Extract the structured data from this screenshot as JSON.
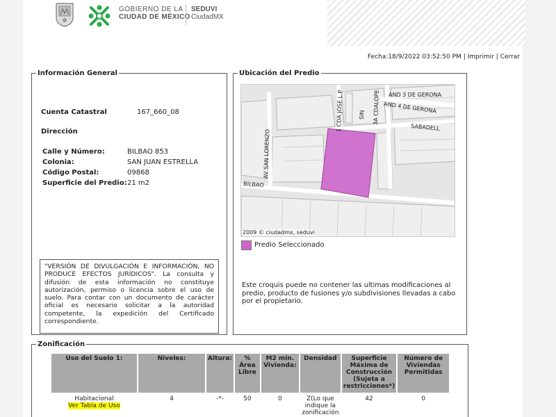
{
  "header": {
    "gov_line1": "GOBIERNO DE LA",
    "gov_line2": "CIUDAD DE MÉXICO",
    "seduvi_line1": "SEDUVI",
    "seduvi_line2": "CiudadMX"
  },
  "topbar": {
    "fecha": "Fecha:18/9/2022 03:52:50 PM",
    "sep": "|",
    "imprimir": "Imprimir",
    "cerrar": "Cerrar"
  },
  "info": {
    "legend": "Información General",
    "cuenta_label": "Cuenta Catastral",
    "cuenta_value": "167_660_08",
    "direccion_label": "Dirección",
    "calle_label": "Calle y Número:",
    "calle_value": "BILBAO 853",
    "colonia_label": "Colonia:",
    "colonia_value": "SAN JUAN ESTRELLA",
    "cp_label": "Código Postal:",
    "cp_value": "09868",
    "superficie_label": "Superficie del Predio:",
    "superficie_value": "21 m2",
    "disclaimer": "\"VERSIÓN DE DIVULGACIÓN E INFORMACIÓN, NO PRODUCE EFECTOS JURÍDICOS\". La consulta y difusión de esta información no constituye autorización, permiso o licencia sobre el uso de suelo. Para contar con un documento de carácter oficial es necesario solicitar a la autoridad competente, la expedición del Certificado correspondiente."
  },
  "ubicacion": {
    "legend": "Ubicación del Predio",
    "map_labels": {
      "gerona3": "AND 3 DE GERONA",
      "gerona4": "AND 4 DE GERONA",
      "jose": "1 CDA JOSE L P",
      "sin": "SIN",
      "cdalope": "3A CDALOPE",
      "sabadell": "SABADELL",
      "lorenzo": "AV SAN LORENZO",
      "bilbao": "BILBAO"
    },
    "map_credit": "2009 © ciudadmx, seduvi",
    "predio_legend": "Predio Seleccionado",
    "note": "Este croquis puede no contener las ultimas modificaciones al predio, producto de fusiones y/o subdivisiones llevadas a cabo por el propietario."
  },
  "zonificacion": {
    "legend": "Zonificación",
    "headers": {
      "uso": "Uso del Suelo 1:",
      "niveles": "Niveles:",
      "altura": "Altura:",
      "area_libre": "% Área Libre",
      "m2_min": "M2 min. Vivienda:",
      "densidad": "Densidad",
      "superficie": "Superficie Máxima de Construcción (Sujeta a restricciones*)",
      "num_viviendas": "Número de Viviendas Permitidas"
    },
    "row": {
      "uso": "Habitacional",
      "ver_tabla": "Ver Tabla de Uso",
      "niveles": "4",
      "altura": "-*-",
      "area_libre": "50",
      "m2_min": "0",
      "densidad": "Z(Lo que indique la zonificación",
      "superficie": "42",
      "num_viviendas": "0"
    }
  },
  "colors": {
    "predio": "#cc66cc",
    "header_cell": "#a9a9a9",
    "highlight": "#ffff00",
    "cdmx_green": "#2ba84a"
  }
}
